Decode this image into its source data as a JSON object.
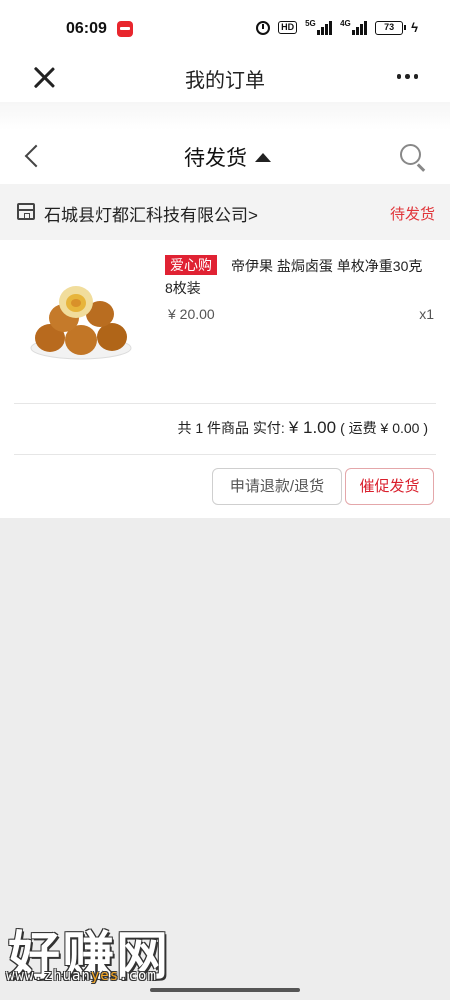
{
  "status_bar": {
    "time": "06:09",
    "hd": "HD",
    "signal_1": "5G",
    "signal_2": "4G",
    "battery": "73"
  },
  "nav": {
    "title": "我的订单"
  },
  "filter": {
    "label": "待发货"
  },
  "shop": {
    "name": "石城县灯都汇科技有限公司>",
    "status": "待发货"
  },
  "order": {
    "tag": "爱心购",
    "title": "帝伊果 盐焗卤蛋 单枚净重30克 8枚装",
    "price": "¥ 20.00",
    "quantity": "x1",
    "summary_count": "共 1 件商品 实付:",
    "summary_paid": "¥ 1.00",
    "summary_shipping": "( 运费 ¥ 0.00 )"
  },
  "actions": {
    "refund": "申请退款/退货",
    "urge": "催促发货"
  },
  "watermark": {
    "main": "好赚网",
    "url_prefix": "www.zhuan",
    "url_highlight": "yes",
    "url_suffix": ".com"
  },
  "colors": {
    "accent_red": "#e0363a",
    "background": "#ededed"
  }
}
